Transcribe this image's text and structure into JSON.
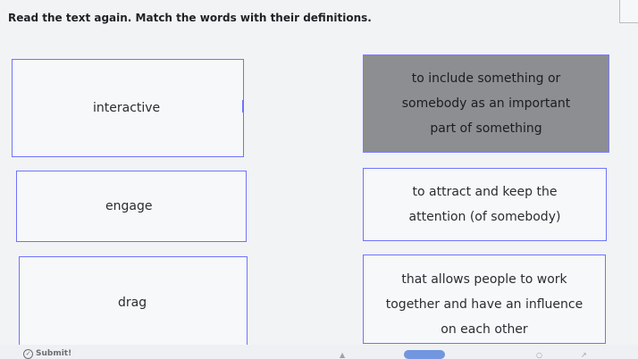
{
  "instruction": "Read the text again. Match the words with their definitions.",
  "words": [
    "interactive",
    "engage",
    "drag"
  ],
  "definitions": [
    {
      "lines": [
        "to include something or",
        "somebody as an important",
        "part of something"
      ],
      "selected": true
    },
    {
      "lines": [
        "to attract and keep the",
        "attention (of somebody)"
      ],
      "selected": false
    },
    {
      "lines": [
        "that allows people to work",
        "together and have an influence",
        "on each other"
      ],
      "selected": false
    }
  ],
  "footer": {
    "submit_label": "Submit!"
  }
}
